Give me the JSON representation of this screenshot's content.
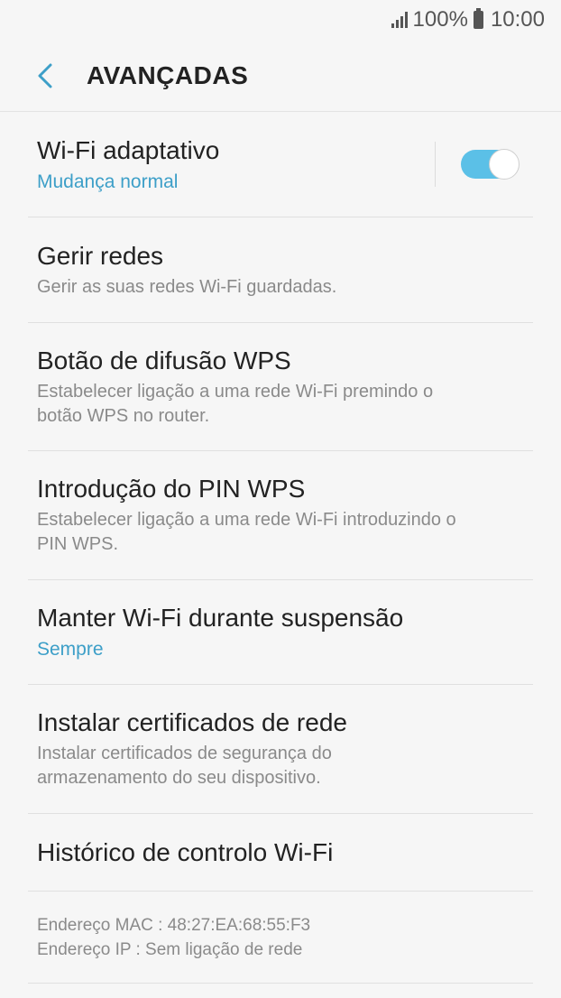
{
  "status_bar": {
    "battery": "100%",
    "time": "10:00"
  },
  "header": {
    "title": "AVANÇADAS"
  },
  "settings": [
    {
      "title": "Wi-Fi adaptativo",
      "subtitle": "Mudança normal",
      "toggle": true
    },
    {
      "title": "Gerir redes",
      "subtitle": "Gerir as suas redes Wi-Fi guardadas."
    },
    {
      "title": "Botão de difusão WPS",
      "subtitle": "Estabelecer ligação a uma rede Wi-Fi premindo o",
      "subtitle2": "botão WPS no router."
    },
    {
      "title": "Introdução do PIN WPS",
      "subtitle": "Estabelecer ligação a uma rede Wi-Fi introduzindo o",
      "subtitle2": "PIN WPS."
    },
    {
      "title": "Manter Wi-Fi durante suspensão",
      "subtitle": "Sempre"
    },
    {
      "title": "Instalar certificados de rede",
      "subtitle": "Instalar certificados de segurança do",
      "subtitle2": "armazenamento do seu dispositivo."
    },
    {
      "title": "Histórico de controlo Wi-Fi"
    }
  ],
  "info": {
    "mac": "Endereço MAC : 48:27:EA:68:55:F3",
    "ip": "Endereço IP : Sem ligação de rede"
  },
  "colors": {
    "accent": "#3d9fc8",
    "toggle_on": "#5bc0e7",
    "background": "#f6f6f6"
  }
}
